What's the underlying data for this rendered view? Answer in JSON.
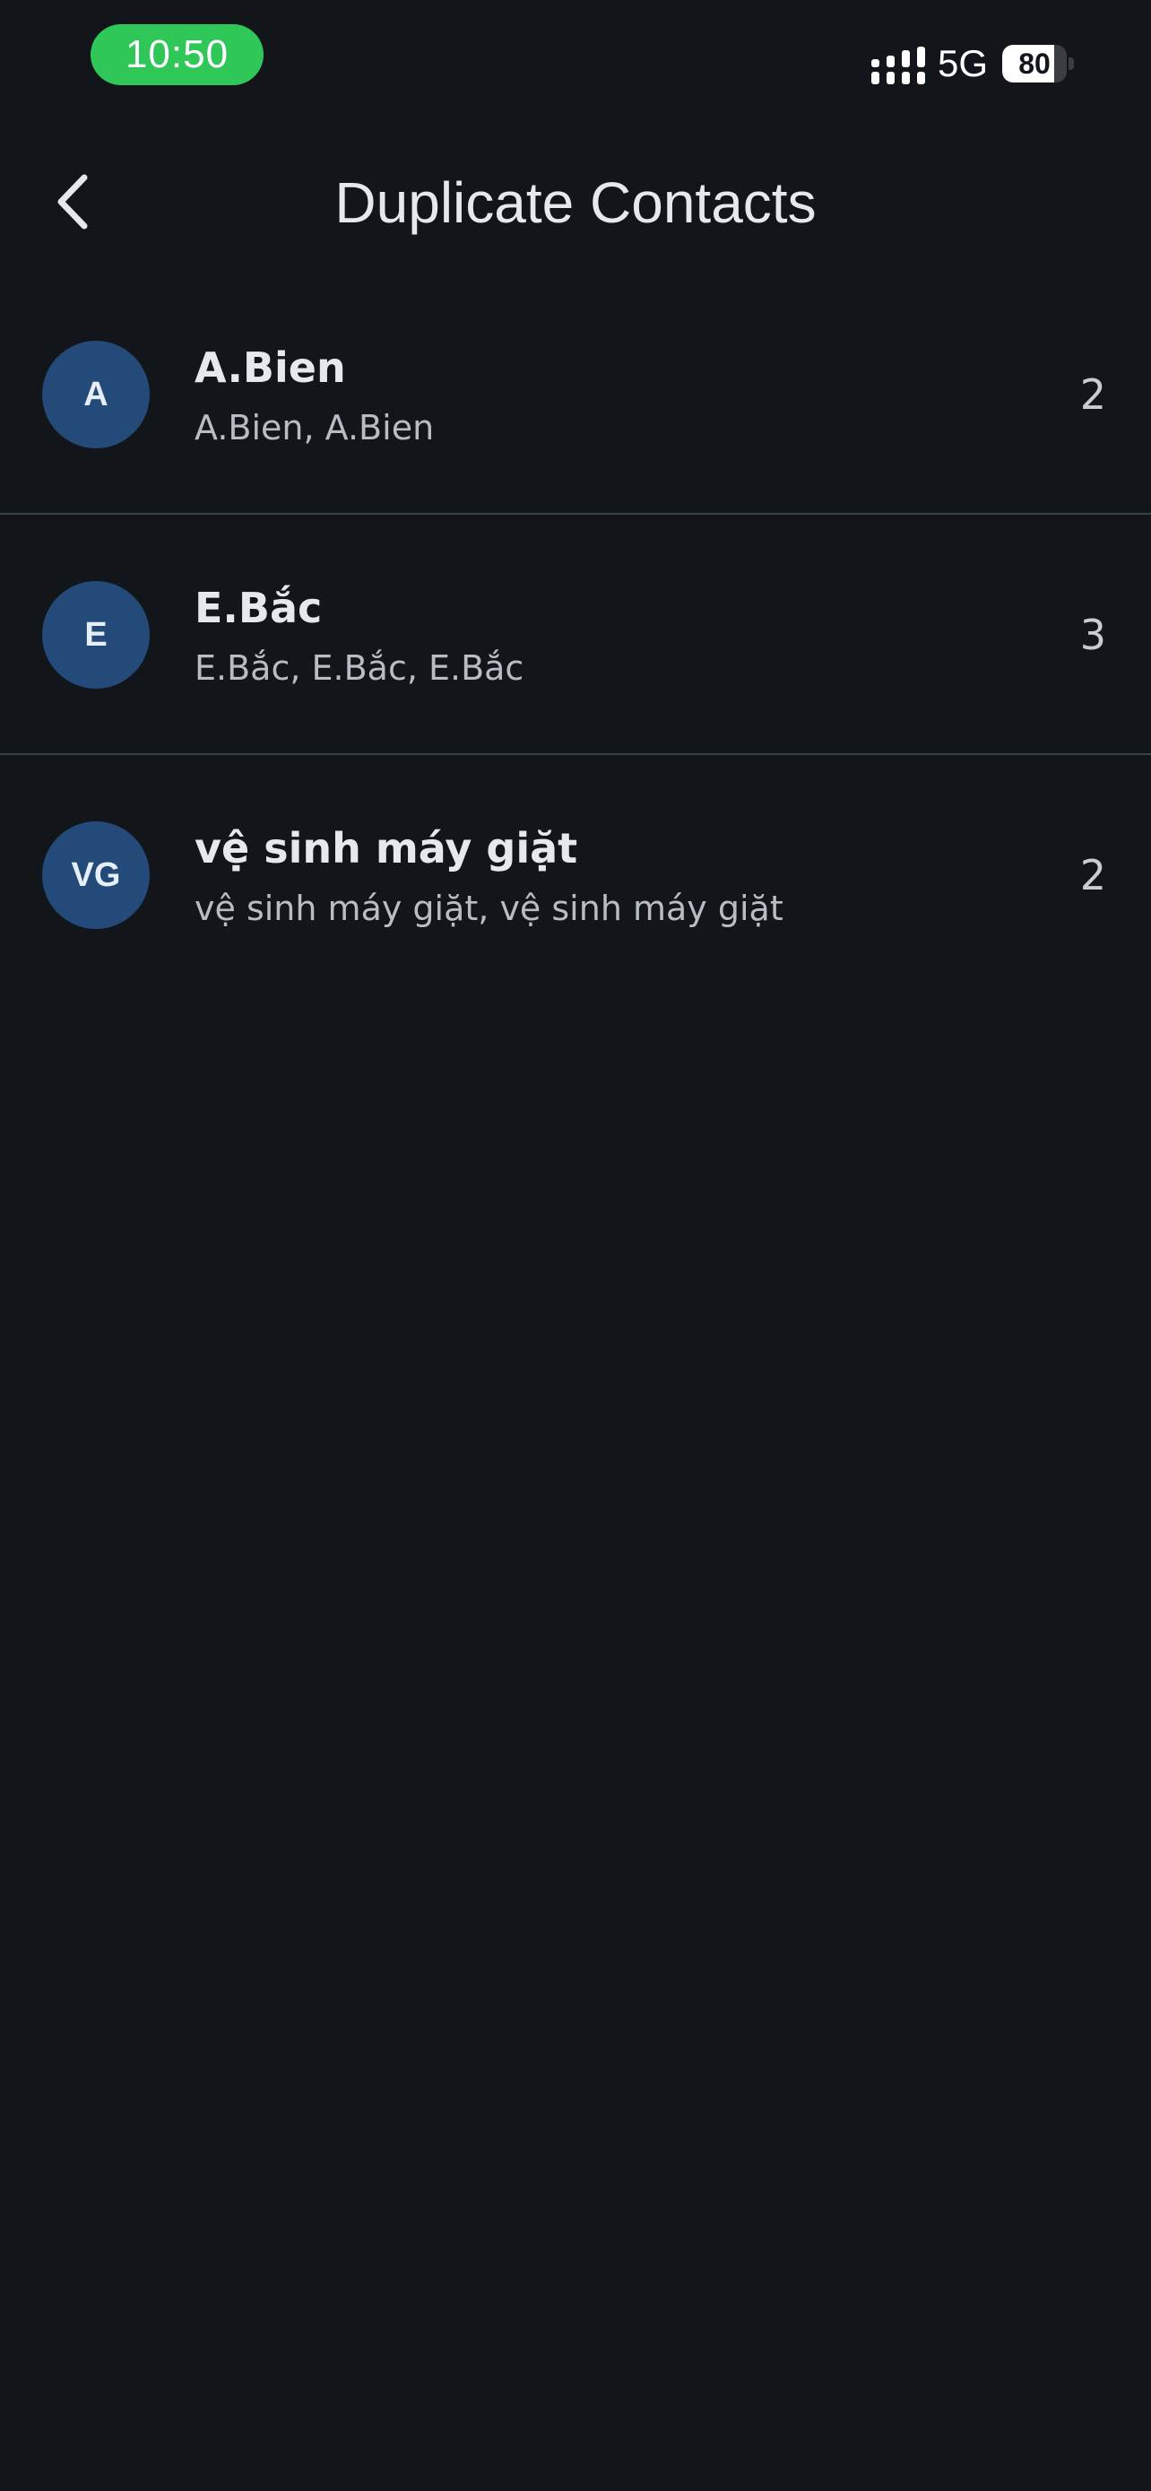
{
  "status_bar": {
    "time": "10:50",
    "network": "5G",
    "battery_level": "80",
    "battery_fraction": 0.8,
    "signal_icon": "cellular-signal-icon",
    "battery_icon": "battery-charging-icon"
  },
  "header": {
    "title": "Duplicate Contacts",
    "back_icon": "chevron-left-icon"
  },
  "colors": {
    "background": "#12151a",
    "time_pill": "#30c759",
    "avatar": "#234a78",
    "divider": "#3b3f46"
  },
  "contacts": [
    {
      "initials": "A",
      "name": "A.Bien",
      "duplicates": "A.Bien, A.Bien",
      "count": "2"
    },
    {
      "initials": "E",
      "name": "E.Bắc",
      "duplicates": "E.Bắc, E.Bắc, E.Bắc",
      "count": "3"
    },
    {
      "initials": "VG",
      "name": "vệ sinh máy giặt",
      "duplicates": "vệ sinh máy giặt, vệ sinh máy giặt",
      "count": "2"
    }
  ]
}
